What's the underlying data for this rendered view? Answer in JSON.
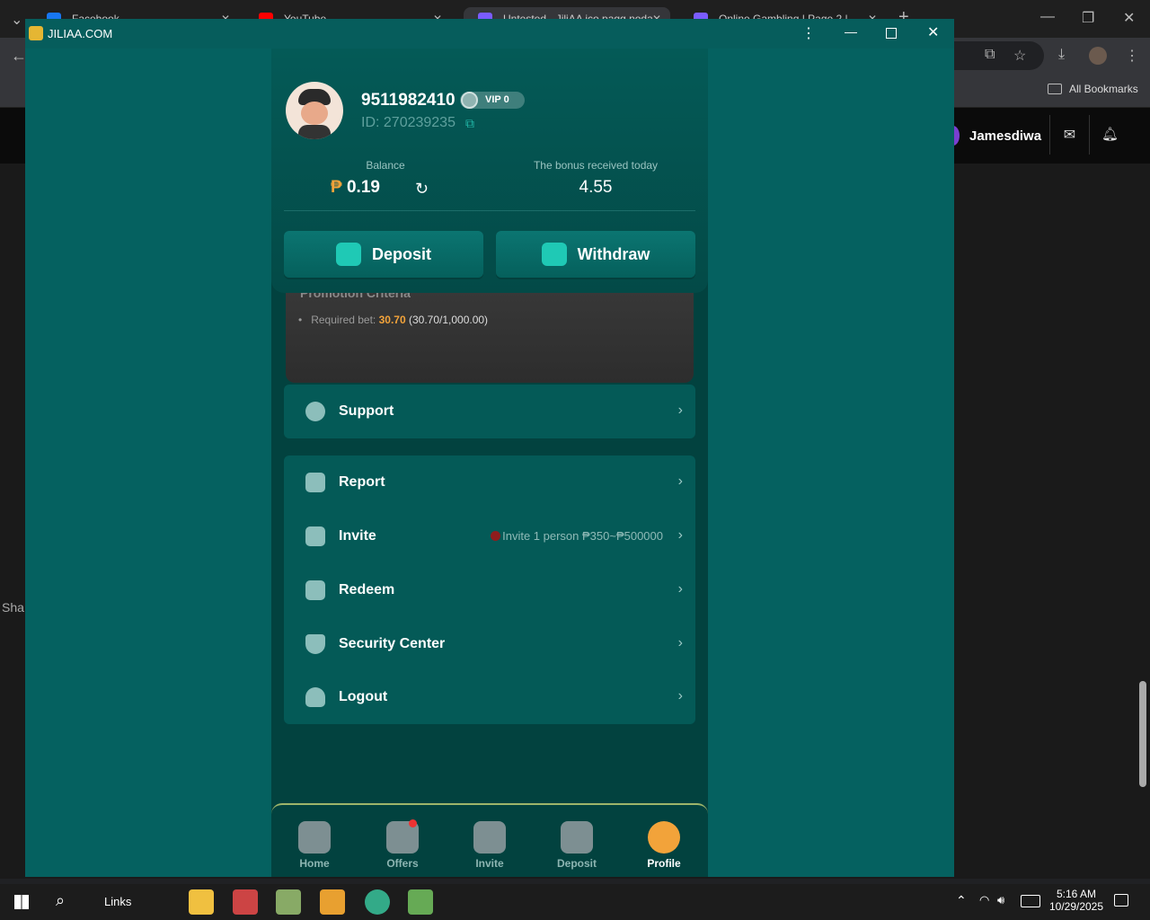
{
  "browser": {
    "tabs": [
      {
        "title": "Facebook"
      },
      {
        "title": "YouTube"
      },
      {
        "title": "Untested - JiliAA ico pagg noda"
      },
      {
        "title": "Online Gambling | Page 2 |"
      }
    ],
    "bookmarks_label": "All Bookmarks",
    "site_username": "Jamesdiwa",
    "side_text": "Sha"
  },
  "app": {
    "window_title": "JILIAA.COM",
    "profile": {
      "phone": "9511982410",
      "vip": "VIP 0",
      "id_text": "ID: 270239235",
      "balance_label": "Balance",
      "balance_currency": "₱",
      "balance_value": "0.19",
      "bonus_label": "The bonus received today",
      "bonus_value": "4.55"
    },
    "actions": {
      "deposit": "Deposit",
      "withdraw": "Withdraw"
    },
    "promo": {
      "title": "Promotion Criteria",
      "bullet_label": "Required bet:",
      "bet_value": "30.70",
      "bet_progress": "(30.70/1,000.00)"
    },
    "menu": {
      "support": "Support",
      "report": "Report",
      "invite": "Invite",
      "invite_note": "Invite 1 person ₱350~₱500000",
      "redeem": "Redeem",
      "security": "Security Center",
      "logout": "Logout"
    },
    "nav": {
      "home": "Home",
      "offers": "Offers",
      "invite": "Invite",
      "deposit": "Deposit",
      "profile": "Profile"
    }
  },
  "taskbar": {
    "links_label": "Links",
    "time": "5:16 AM",
    "date": "10/29/2025"
  },
  "colors": {
    "accent": "#056160",
    "highlight": "#f2a33a"
  }
}
